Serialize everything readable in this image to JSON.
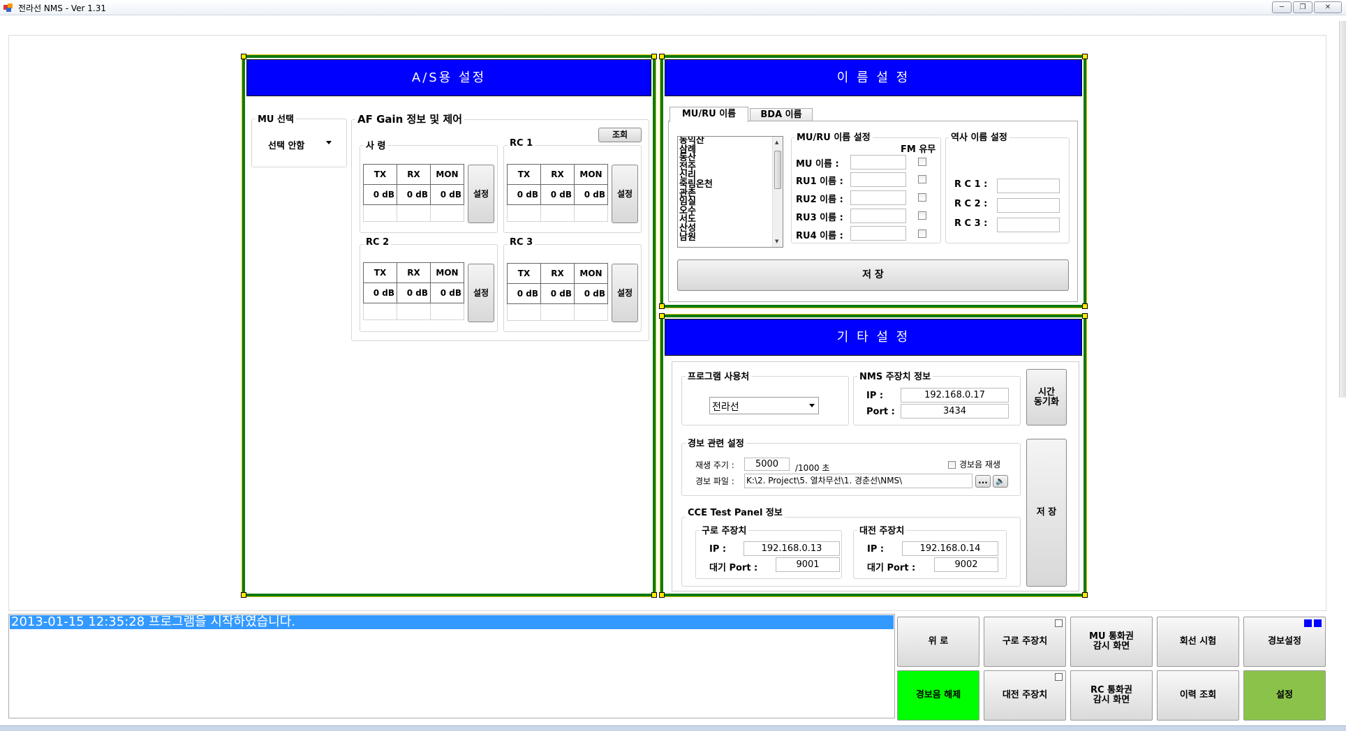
{
  "window": {
    "title": "전라선 NMS  - Ver 1.31",
    "minimize": "─",
    "maximize": "❐",
    "close": "✕"
  },
  "as_panel": {
    "title": "A/S용 설정",
    "mu_select": {
      "label": "MU 선택",
      "value": "선택 안함"
    },
    "af_gain": {
      "label": "AF Gain 정보 및 제어",
      "query_button": "조회",
      "groups": [
        {
          "name": "사 령",
          "headers": [
            "TX",
            "RX",
            "MON"
          ],
          "values": [
            "0 dB",
            "0 dB",
            "0 dB"
          ],
          "button": "설정"
        },
        {
          "name": "RC 1",
          "headers": [
            "TX",
            "RX",
            "MON"
          ],
          "values": [
            "0 dB",
            "0 dB",
            "0 dB"
          ],
          "button": "설정"
        },
        {
          "name": "RC 2",
          "headers": [
            "TX",
            "RX",
            "MON"
          ],
          "values": [
            "0 dB",
            "0 dB",
            "0 dB"
          ],
          "button": "설정"
        },
        {
          "name": "RC 3",
          "headers": [
            "TX",
            "RX",
            "MON"
          ],
          "values": [
            "0 dB",
            "0 dB",
            "0 dB"
          ],
          "button": "설정"
        }
      ]
    }
  },
  "name_panel": {
    "title": "이 름 설 정",
    "tabs": [
      "MU/RU 이름",
      "BDA 이름"
    ],
    "list_items": [
      "동익산",
      "삼례",
      "동산",
      "전주",
      "신리",
      "죽림온천",
      "관촌",
      "임실",
      "오수",
      "서도",
      "산성",
      "남원"
    ],
    "mu_ru_group": {
      "label": "MU/RU 이름 설정",
      "fm_label": "FM 유무",
      "rows": [
        {
          "label": "MU 이름 :"
        },
        {
          "label": "RU1 이름 :"
        },
        {
          "label": "RU2 이름 :"
        },
        {
          "label": "RU3 이름 :"
        },
        {
          "label": "RU4 이름 :"
        }
      ]
    },
    "station_group": {
      "label": "역사 이름 설정",
      "rows": [
        "R C 1 :",
        "R C 2 :",
        "R C 3 :"
      ]
    },
    "save_button": "저 장"
  },
  "etc_panel": {
    "title": "기 타 설 정",
    "program_user": {
      "label": "프로그램 사용처",
      "value": "전라선"
    },
    "nms_info": {
      "label": "NMS 주장치 정보",
      "ip_label": "IP :",
      "ip": "192.168.0.17",
      "port_label": "Port :",
      "port": "3434"
    },
    "time_sync_button": [
      "시간",
      "동기화"
    ],
    "alarm": {
      "label": "경보 관련 설정",
      "period_label": "재생 주기 :",
      "period": "5000",
      "period_unit": "/1000 초",
      "sound_label": "경보음 재생",
      "file_label": "경보 파일 :",
      "file_path": "K:\\2. Project\\5. 열차무선\\1. 경춘선\\NMS\\",
      "browse": "...",
      "speaker": "🔈"
    },
    "save_button": "저 장",
    "cce": {
      "label": "CCE Test Panel 정보",
      "guro": {
        "label": "구로 주장치",
        "ip_label": "IP :",
        "ip": "192.168.0.13",
        "port_label": "대기 Port :",
        "port": "9001"
      },
      "daejeon": {
        "label": "대전 주장치",
        "ip_label": "IP :",
        "ip": "192.168.0.14",
        "port_label": "대기 Port :",
        "port": "9002"
      }
    }
  },
  "log": {
    "message": "2013-01-15 12:35:28 프로그램을 시작하였습니다."
  },
  "bottom_buttons": {
    "row1": [
      [
        "위 로"
      ],
      [
        "구로 주장치"
      ],
      [
        "MU 통화권",
        "감시 화면"
      ],
      [
        "회선 시험"
      ],
      [
        "경보설정"
      ]
    ],
    "row2": [
      [
        "경보음 해제"
      ],
      [
        "대전 주장치"
      ],
      [
        "RC 통화권",
        "감시 화면"
      ],
      [
        "이력 조회"
      ],
      [
        "설정"
      ]
    ]
  },
  "colors": {
    "panel_border": "#0d7a10",
    "header_blue": "#0000ff",
    "alarm_off_green": "#00ff00",
    "settings_green": "#8bc34a",
    "log_highlight": "#3399ff"
  }
}
